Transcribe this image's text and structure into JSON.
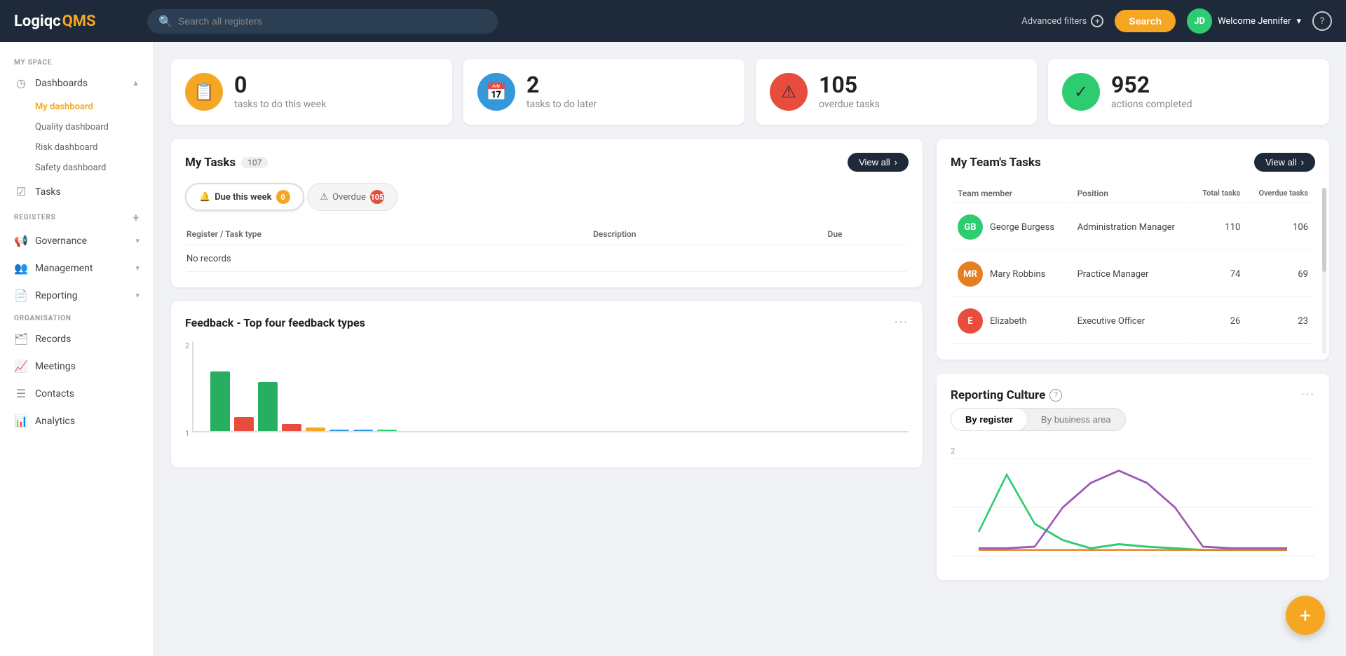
{
  "app": {
    "name_logiqc": "Logiqc",
    "name_qms": "QMS",
    "logo_initials": "JD"
  },
  "topnav": {
    "search_placeholder": "Search all registers",
    "advanced_filters_label": "Advanced filters",
    "search_button_label": "Search",
    "user_greeting": "Welcome Jennifer",
    "user_initials": "JD",
    "user_avatar_color": "#2ecc71"
  },
  "sidebar": {
    "my_space_label": "MY SPACE",
    "dashboards_label": "Dashboards",
    "my_dashboard_label": "My dashboard",
    "quality_dashboard_label": "Quality dashboard",
    "risk_dashboard_label": "Risk dashboard",
    "safety_dashboard_label": "Safety dashboard",
    "tasks_label": "Tasks",
    "registers_label": "REGISTERS",
    "governance_label": "Governance",
    "management_label": "Management",
    "reporting_label": "Reporting",
    "organisation_label": "ORGANISATION",
    "records_label": "Records",
    "meetings_label": "Meetings",
    "contacts_label": "Contacts",
    "analytics_label": "Analytics"
  },
  "stats": [
    {
      "id": "tasks_this_week",
      "number": "0",
      "label": "tasks to do this week",
      "icon": "📋",
      "color_class": "orange"
    },
    {
      "id": "tasks_later",
      "number": "2",
      "label": "tasks to do later",
      "icon": "📅",
      "color_class": "blue"
    },
    {
      "id": "overdue_tasks",
      "number": "105",
      "label": "overdue tasks",
      "icon": "⚠",
      "color_class": "red"
    },
    {
      "id": "actions_completed",
      "number": "952",
      "label": "actions completed",
      "icon": "✓",
      "color_class": "green"
    }
  ],
  "my_tasks": {
    "title": "My Tasks",
    "count": "107",
    "view_all_label": "View all",
    "tabs": [
      {
        "id": "due_this_week",
        "label": "Due this week",
        "badge": "0",
        "badge_color": "orange",
        "icon": "🔔",
        "active": true
      },
      {
        "id": "overdue",
        "label": "Overdue",
        "badge": "105",
        "badge_color": "red",
        "icon": "⚠",
        "active": false
      }
    ],
    "table_headers": [
      "Register / Task type",
      "Description",
      "Due"
    ],
    "no_records_text": "No records"
  },
  "my_teams_tasks": {
    "title": "My Team's Tasks",
    "view_all_label": "View all",
    "column_headers": [
      "Team member",
      "Position",
      "Total tasks",
      "Overdue tasks"
    ],
    "members": [
      {
        "initials": "GB",
        "name": "George Burgess",
        "position": "Administration Manager",
        "total_tasks": "110",
        "overdue_tasks": "106",
        "avatar_color": "#2ecc71"
      },
      {
        "initials": "MR",
        "name": "Mary Robbins",
        "position": "Practice Manager",
        "total_tasks": "74",
        "overdue_tasks": "69",
        "avatar_color": "#e67e22"
      },
      {
        "initials": "E",
        "name": "Elizabeth",
        "position": "Executive Officer",
        "total_tasks": "26",
        "overdue_tasks": "23",
        "avatar_color": "#e74c3c"
      }
    ]
  },
  "feedback": {
    "title": "Feedback - Top four feedback types",
    "dots_menu": "···",
    "y_max": "2",
    "y_min": "1",
    "bars": [
      {
        "label": "",
        "height_pct": 85,
        "color": "#27ae60"
      },
      {
        "label": "",
        "height_pct": 20,
        "color": "#e74c3c"
      },
      {
        "label": "",
        "height_pct": 70,
        "color": "#e74c3c"
      },
      {
        "label": "",
        "height_pct": 10,
        "color": "#27ae60"
      },
      {
        "label": "",
        "height_pct": 5,
        "color": "#f5a623"
      },
      {
        "label": "",
        "height_pct": 0,
        "color": "#3498db"
      },
      {
        "label": "",
        "height_pct": 0,
        "color": "#3498db"
      },
      {
        "label": "",
        "height_pct": 0,
        "color": "#2ecc71"
      }
    ]
  },
  "reporting_culture": {
    "title": "Reporting Culture",
    "toggle_by_register": "By register",
    "toggle_by_business_area": "By business area",
    "active_toggle": "by_register",
    "y_max": "2",
    "help_icon": "?"
  },
  "fab": {
    "icon": "+"
  }
}
